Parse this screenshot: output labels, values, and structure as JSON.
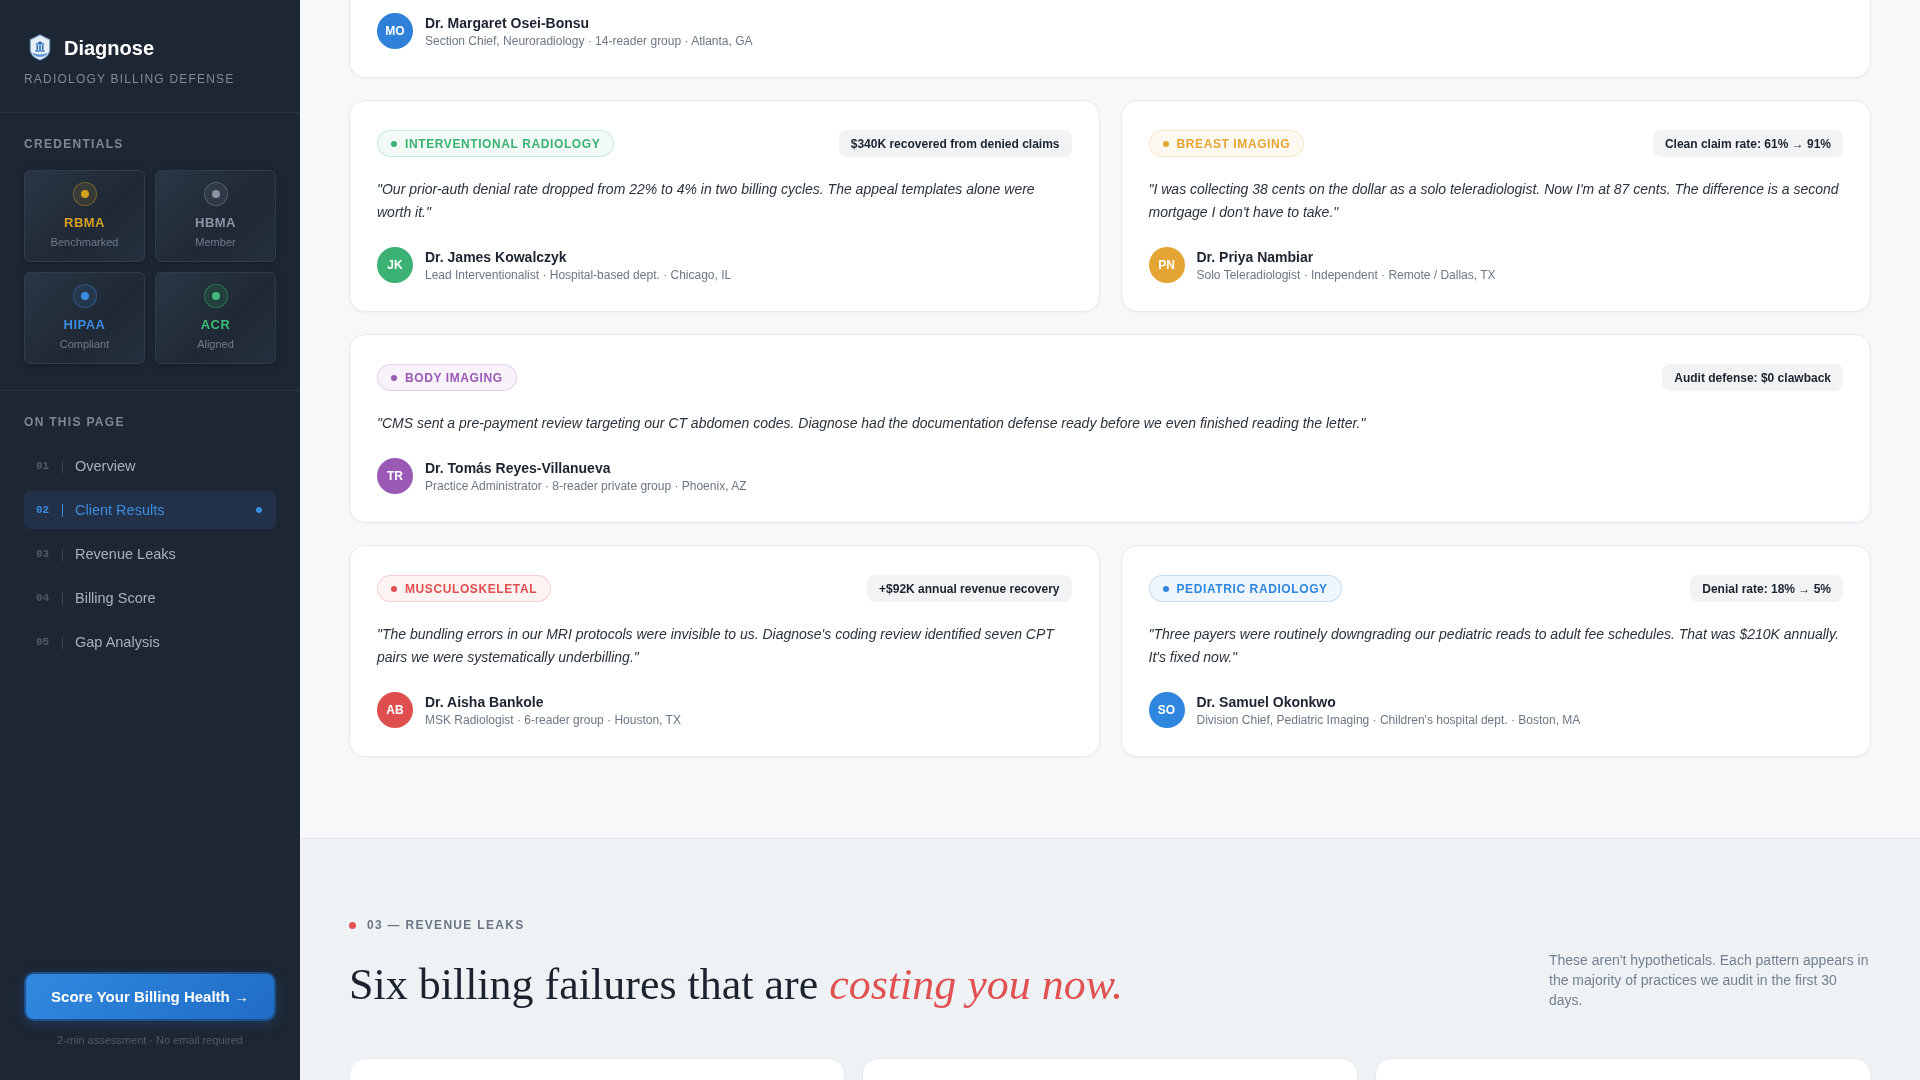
{
  "sidebar": {
    "brand": "Diagnose",
    "tagline": "RADIOLOGY BILLING DEFENSE",
    "credentials_title": "CREDENTIALS",
    "credentials": [
      {
        "name": "RBMA",
        "status": "Benchmarked",
        "color": "#d4a020"
      },
      {
        "name": "HBMA",
        "status": "Member",
        "color": "#8a94a3"
      },
      {
        "name": "HIPAA",
        "status": "Compliant",
        "color": "#3b8de0"
      },
      {
        "name": "ACR",
        "status": "Aligned",
        "color": "#3dbb77"
      }
    ],
    "nav_title": "ON THIS PAGE",
    "nav": [
      {
        "number": "01",
        "label": "Overview",
        "selected": false
      },
      {
        "number": "02",
        "label": "Client Results",
        "selected": true
      },
      {
        "number": "03",
        "label": "Revenue Leaks",
        "selected": false
      },
      {
        "number": "04",
        "label": "Billing Score",
        "selected": false
      },
      {
        "number": "05",
        "label": "Gap Analysis",
        "selected": false
      }
    ],
    "cta": {
      "label": "Score Your Billing Health →",
      "note": "2-min assessment · No email required"
    }
  },
  "testimonials": {
    "previous": {
      "author": {
        "initials": "MO",
        "name": "Dr. Margaret Osei-Bonsu",
        "meta": "Section Chief, Neuroradiology · 14-reader group · Atlanta, GA"
      }
    },
    "cards": [
      {
        "kind": "half",
        "tag": "INTERVENTIONAL RADIOLOGY",
        "color": "#3bb273",
        "stat": "$340K recovered from denied claims",
        "quote": "\"Our prior-auth denial rate dropped from 22% to 4% in two billing cycles. The appeal templates alone were worth it.\"",
        "author": {
          "initials": "JK",
          "name": "Dr. James Kowalczyk",
          "meta": "Lead Interventionalist · Hospital-based dept. · Chicago, IL"
        }
      },
      {
        "kind": "half",
        "tag": "BREAST IMAGING",
        "color": "#e5a535",
        "stat": "Clean claim rate: 61% → 91%",
        "quote": "\"I was collecting 38 cents on the dollar as a solo teleradiologist. Now I'm at 87 cents. The difference is a second mortgage I don't have to take.\"",
        "author": {
          "initials": "PN",
          "name": "Dr. Priya Nambiar",
          "meta": "Solo Teleradiologist · Independent · Remote / Dallas, TX"
        }
      },
      {
        "kind": "wide",
        "tag": "BODY IMAGING",
        "color": "#9b59b6",
        "stat": "Audit defense: $0 clawback",
        "quote": "\"CMS sent a pre-payment review targeting our CT abdomen codes. Diagnose had the documentation defense ready before we even finished reading the letter.\"",
        "author": {
          "initials": "TR",
          "name": "Dr. Tomás Reyes-Villanueva",
          "meta": "Practice Administrator · 8-reader private group · Phoenix, AZ"
        }
      },
      {
        "kind": "half",
        "tag": "MUSCULOSKELETAL",
        "color": "#e04f4f",
        "stat": "+$92K annual revenue recovery",
        "quote": "\"The bundling errors in our MRI protocols were invisible to us. Diagnose's coding review identified seven CPT pairs we were systematically underbilling.\"",
        "author": {
          "initials": "AB",
          "name": "Dr. Aisha Bankole",
          "meta": "MSK Radiologist · 6-reader group · Houston, TX"
        }
      },
      {
        "kind": "half",
        "tag": "PEDIATRIC RADIOLOGY",
        "color": "#2f86de",
        "stat": "Denial rate: 18% → 5%",
        "quote": "\"Three payers were routinely downgrading our pediatric reads to adult fee schedules. That was $210K annually. It's fixed now.\"",
        "author": {
          "initials": "SO",
          "name": "Dr. Samuel Okonkwo",
          "meta": "Division Chief, Pediatric Imaging · Children's hospital dept. · Boston, MA"
        }
      }
    ]
  },
  "revenue_leaks": {
    "label": "03 — REVENUE LEAKS",
    "heading": "Six billing failures that are *costing you now.*",
    "description": "These aren't hypotheticals. Each pattern appears in the majority of practices we audit in the first 30 days."
  }
}
